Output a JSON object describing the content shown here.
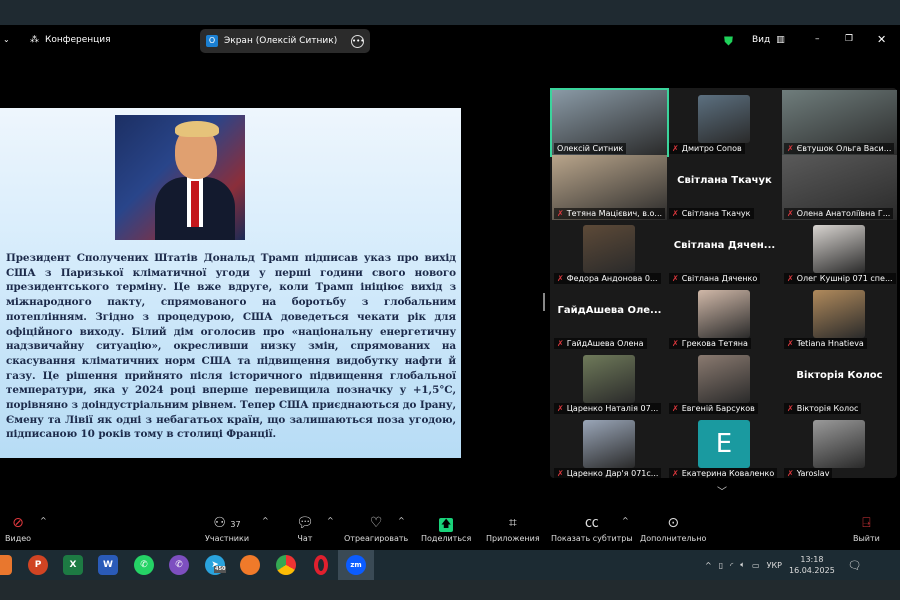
{
  "titlebar": {
    "meeting_label": "Конференция",
    "share_label": "Экран (Олексій Ситник)",
    "view_label": "Вид"
  },
  "slide": {
    "text": "Президент Сполучених Штатів Дональд Трамп підписав указ про вихід США з Паризької кліматичної угоди у перші години свого нового президентського терміну. Це вже вдруге, коли Трамп ініціює вихід з міжнародного пакту, спрямованого на боротьбу з глобальним потеплінням. Згідно з процедурою, США доведеться чекати рік для офіційного виходу. Білий дім оголосив про «національну енергетичну надзвичайну ситуацію», окресливши низку змін, спрямованих на скасування кліматичних норм США та підвищення видобутку нафти й газу. Це рішення прийнято після історичного підвищення глобальної температури, яка у 2024 році вперше перевищила позначку у +1,5°С, порівняно з доіндустріальним рівнем. Тепер США приєднаються до Ірану, Ємену та Лівії як одні з небагатьох країн, що залишаються поза угодою, підписаною 10 років тому в столиці Франції."
  },
  "participants": [
    {
      "name": "Олексій Ситник",
      "type": "video",
      "color": "#8a9aa6"
    },
    {
      "name": "Дмитро Сопов",
      "type": "video",
      "color": "#5c7080"
    },
    {
      "name": "Євтушок Ольга Васи...",
      "type": "video",
      "color": "#6f7d7c"
    },
    {
      "name": "Тетяна Мацієвич, в.о...",
      "type": "video",
      "color": "#b9a58b"
    },
    {
      "name": "Світлана Ткачук",
      "type": "text",
      "big": "Світлана Ткачук"
    },
    {
      "name": "Олена Анатоліївна Г...",
      "type": "video",
      "color": "#5a5a5a"
    },
    {
      "name": "Федора Андонова 0...",
      "type": "video",
      "color": "#5d4a38"
    },
    {
      "name": "Світлана Дяченко",
      "type": "text",
      "big": "Світлана Дячен..."
    },
    {
      "name": "Олег Кушнір 071 спе...",
      "type": "video",
      "color": "#d8d4d0"
    },
    {
      "name": "ГайдАшева Олена",
      "type": "text",
      "big": "ГайдАшева Оле..."
    },
    {
      "name": "Грекова Тетяна",
      "type": "video",
      "color": "#d0b8a8"
    },
    {
      "name": "Tetiana Hnatieva",
      "type": "video",
      "color": "#b08a5c"
    },
    {
      "name": "Царенко Наталія 07...",
      "type": "video",
      "color": "#6f7a5a"
    },
    {
      "name": "Евгеній Барсуков",
      "type": "video",
      "color": "#8a7a70"
    },
    {
      "name": "Вікторія Колос",
      "type": "text",
      "big": "Вікторія Колос"
    },
    {
      "name": "Царенко Дар'я  071с...",
      "type": "video",
      "color": "#9aa6b8"
    },
    {
      "name": "Екатерина Коваленко",
      "type": "avatar",
      "letter": "E",
      "color": "#1a9aa0"
    },
    {
      "name": "Yaroslav",
      "type": "video",
      "color": "#9a9a9a"
    }
  ],
  "toolbar": {
    "video": "Видео",
    "participants": "Участники",
    "participants_count": "37",
    "chat": "Чат",
    "react": "Отреагировать",
    "share": "Поделиться",
    "apps": "Приложения",
    "captions": "Показать субтитры",
    "more": "Дополнительно",
    "leave": "Выйти",
    "share_color": "#19d27a"
  },
  "taskbar": {
    "apps": [
      "PowerPoint",
      "Excel",
      "Word",
      "WhatsApp",
      "Viber",
      "Telegram",
      "Firefox",
      "Chrome",
      "Opera",
      "Zoom"
    ],
    "telegram_badge": "450",
    "language": "УКР",
    "time": "13:18",
    "date": "16.04.2025"
  }
}
